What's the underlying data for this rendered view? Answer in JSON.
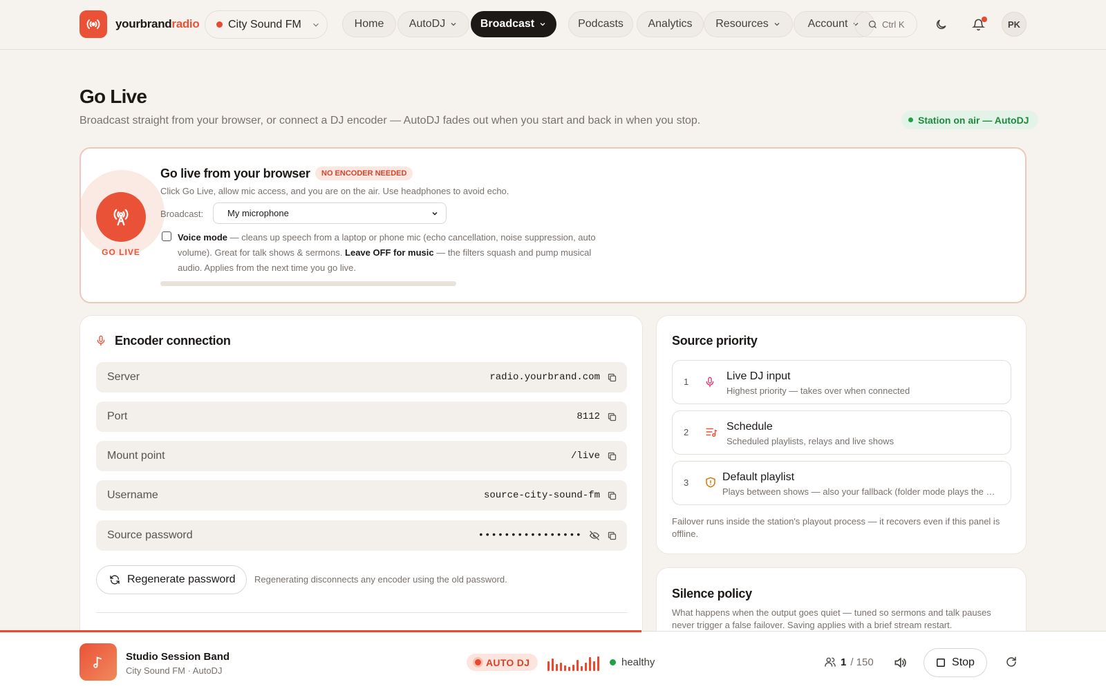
{
  "brand": {
    "name_main": "yourbrand",
    "name_accent": "radio"
  },
  "station_select": {
    "label": "City Sound FM"
  },
  "nav": [
    {
      "label": "Home",
      "has_chevron": false,
      "active": false
    },
    {
      "label": "AutoDJ",
      "has_chevron": true,
      "active": false
    },
    {
      "label": "Broadcast",
      "has_chevron": true,
      "active": true
    },
    {
      "label": "Podcasts",
      "has_chevron": false,
      "active": false
    },
    {
      "label": "Analytics",
      "has_chevron": false,
      "active": false
    },
    {
      "label": "Resources",
      "has_chevron": true,
      "active": false
    },
    {
      "label": "Account",
      "has_chevron": true,
      "active": false
    }
  ],
  "search": {
    "shortcut": "Ctrl K"
  },
  "user": {
    "initials": "PK"
  },
  "page": {
    "title": "Go Live",
    "subtitle": "Broadcast straight from your browser, or connect a DJ encoder — AutoDJ fades out when you start and back in when you stop.",
    "status": "Station on air — AutoDJ"
  },
  "golive": {
    "button_label": "GO LIVE",
    "title": "Go live from your browser",
    "badge": "NO ENCODER NEEDED",
    "description": "Click Go Live, allow mic access, and you are on the air. Use headphones to avoid echo.",
    "broadcast_label": "Broadcast:",
    "broadcast_value": "My microphone",
    "voice_mode_label": "Voice mode",
    "voice_mode_text1": " — cleans up speech from a laptop or phone mic (echo cancellation, noise suppression, auto volume). Great for talk shows & sermons. ",
    "voice_mode_bold": "Leave OFF for music",
    "voice_mode_text2": " — the filters squash and pump musical audio. Applies from the next time you go live.",
    "voice_mode_checked": false
  },
  "encoder": {
    "title": "Encoder connection",
    "fields": [
      {
        "label": "Server",
        "value": "radio.yourbrand.com"
      },
      {
        "label": "Port",
        "value": "8112"
      },
      {
        "label": "Mount point",
        "value": "/live"
      },
      {
        "label": "Username",
        "value": "source-city-sound-fm"
      },
      {
        "label": "Source password",
        "value": "••••••••••••••••"
      }
    ],
    "regen_label": "Regenerate password",
    "regen_note": "Regenerating disconnects any encoder using the old password."
  },
  "source_priority": {
    "title": "Source priority",
    "items": [
      {
        "num": "1",
        "name": "Live DJ input",
        "desc": "Highest priority — takes over when connected",
        "icon": "mic-icon"
      },
      {
        "num": "2",
        "name": "Schedule",
        "desc": "Scheduled playlists, relays and live shows",
        "icon": "playlist-icon"
      },
      {
        "num": "3",
        "name": "Default playlist",
        "desc": "Plays between shows — also your fallback (folder mode plays the whole library)",
        "icon": "shield-icon"
      }
    ],
    "note": "Failover runs inside the station's playout process — it recovers even if this panel is offline."
  },
  "silence": {
    "title": "Silence policy",
    "description": "What happens when the output goes quiet — tuned so sermons and talk pauses never trigger a false failover. Saving applies with a brief stream restart."
  },
  "player": {
    "track_title": "Studio Session Band",
    "track_sub": "City Sound FM · AutoDJ",
    "badge": "AUTO DJ",
    "health": "healthy",
    "listeners_current": "1",
    "listeners_max": "/ 150",
    "stop_label": "Stop",
    "progress": 0.58
  },
  "colors": {
    "accent": "#ea5237",
    "on_air": "#1fa046",
    "dark": "#1c1917"
  }
}
